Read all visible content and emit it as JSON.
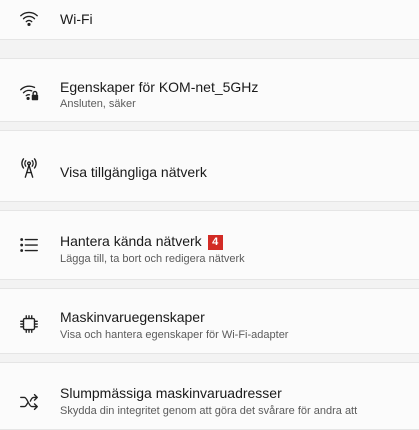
{
  "settings": {
    "wifi": {
      "title": "Wi-Fi",
      "icon": "wifi-icon"
    },
    "properties": {
      "title": "Egenskaper för KOM-net_5GHz",
      "subtitle": "Ansluten, säker",
      "icon": "wifi-secure-icon"
    },
    "available": {
      "title": "Visa tillgängliga nätverk",
      "icon": "antenna-icon"
    },
    "known": {
      "title": "Hantera kända nätverk",
      "badge": "4",
      "subtitle": "Lägga till, ta bort och redigera nätverk",
      "icon": "list-icon"
    },
    "hardware": {
      "title": "Maskinvaruegenskaper",
      "subtitle": "Visa och hantera egenskaper för Wi-Fi-adapter",
      "icon": "chip-icon"
    },
    "random": {
      "title": "Slumpmässiga maskinvaruadresser",
      "subtitle": "Skydda din integritet genom att göra det svårare för andra att",
      "icon": "shuffle-icon"
    }
  },
  "colors": {
    "badge": "#d22b25",
    "background": "#f3f3f3",
    "card": "#fbfbfb"
  }
}
